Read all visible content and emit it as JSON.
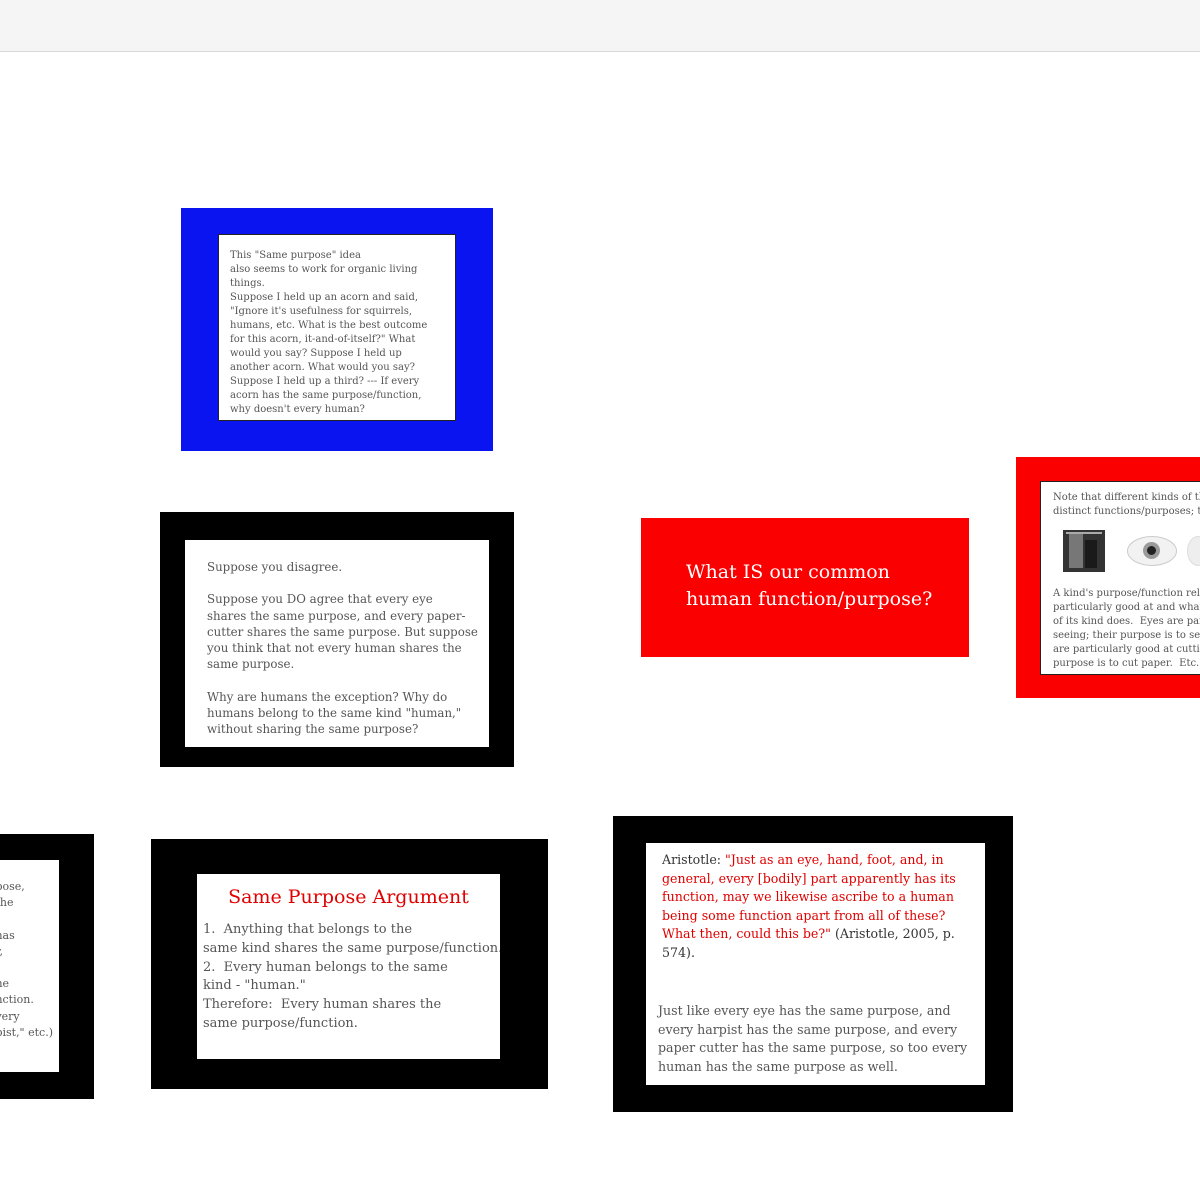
{
  "cards": {
    "acorn": {
      "text": "This \"Same purpose\" idea\nalso seems to work for organic living things.\nSuppose I held up an acorn and said,\n\"Ignore it's usefulness for squirrels,\nhumans, etc.   What is the best outcome\nfor this acorn, it-and-of-itself?\"  What\nwould you say?  Suppose I held up\nanother acorn.  What would you say?\nSuppose I held up a third?  --- If every\nacorn has the same purpose/function,\nwhy doesn't every human?"
    },
    "disagree": {
      "text": "Suppose you disagree.\n\nSuppose you DO agree that every eye\nshares the same purpose, and every paper-\ncutter shares the same purpose.   But suppose\nyou think that not every human shares the\nsame purpose.\n\nWhy are humans the exception?  Why do\nhumans belong to the same kind \"human,\"\nwithout sharing the same purpose?"
    },
    "question": {
      "text": "What IS our common\nhuman function/purpose?"
    },
    "note": {
      "top": "Note that different kinds of th\ndistinct functions/purposes; th",
      "bottom": "A kind's purpose/function rela\nparticularly good at and what\nof its kind does.  Eyes are part\nseeing; their purpose is to see.\nare particularly good at cuttin\npurpose is to cut paper.  Etc."
    },
    "left_partial": {
      "text": "pose,\nthe\n\nhas\nr,\n\nhe\nnction.\nvery\npist,\" etc.)"
    },
    "argument": {
      "title": "Same Purpose Argument",
      "body": "1.  Anything that belongs to the\nsame kind shares the same purpose/function.\n2.  Every human belongs to the same\nkind - \"human.\"\nTherefore:  Every human shares the\nsame purpose/function."
    },
    "aristotle": {
      "label": "Aristotle:  ",
      "quote": "\"Just as an eye, hand, foot, and, in general, every [bodily] part apparently has its function, may we likewise ascribe to a human being some function apart from all of these? What then, could this be?\"",
      "cite": " (Aristotle, 2005, p. 574).",
      "body": "Just like every eye has the same purpose, and every harpist has the same purpose, and every paper cutter has the same purpose, so too every human has the same purpose as well."
    }
  },
  "colors": {
    "blue": "#0a14f0",
    "black": "#000000",
    "red": "#fa0000"
  }
}
